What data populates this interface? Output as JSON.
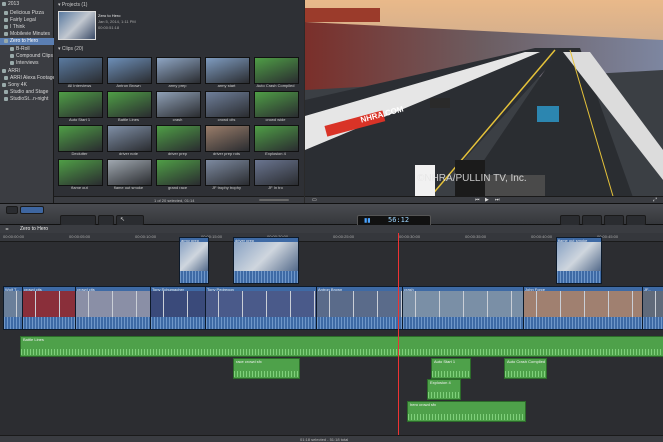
{
  "sidebar": {
    "items": [
      {
        "label": "2013",
        "selected": false
      },
      {
        "label": "Delicious Pizza",
        "selected": false
      },
      {
        "label": "Fairly Legal",
        "selected": false
      },
      {
        "label": "I Think",
        "selected": false
      },
      {
        "label": "Mobilevie Minutes",
        "selected": false
      },
      {
        "label": "Zero to Hero",
        "selected": true
      },
      {
        "label": "B-Roll",
        "selected": false
      },
      {
        "label": "Compound Clips",
        "selected": false
      },
      {
        "label": "Interviews",
        "selected": false
      },
      {
        "label": "ARRI",
        "selected": false
      },
      {
        "label": "ARRI Alexa Footage",
        "selected": false
      },
      {
        "label": "Sony 4K",
        "selected": false
      },
      {
        "label": "Studio and Stage",
        "selected": false
      },
      {
        "label": "StudioSt...n-night",
        "selected": false
      }
    ]
  },
  "browser": {
    "projects_label": "Projects",
    "projects_count": "(1)",
    "project": {
      "name": "Zero to Hero",
      "date": "Jan 5, 2014, 1:11 PM",
      "duration": "00:00:51:18"
    },
    "clips_label": "Clips",
    "clips_count": "(20)",
    "clips": [
      {
        "label": "All Interviews"
      },
      {
        "label": "Antron Brown"
      },
      {
        "label": "army prep"
      },
      {
        "label": "army start"
      },
      {
        "label": "Auto Crash Compiled"
      },
      {
        "label": "Auto Start 1"
      },
      {
        "label": "Battle Lines"
      },
      {
        "label": "crash"
      },
      {
        "label": "crowd cits"
      },
      {
        "label": "crowd wide"
      },
      {
        "label": "Declutter"
      },
      {
        "label": "driver note"
      },
      {
        "label": "driver prep"
      },
      {
        "label": "driver prep rots"
      },
      {
        "label": "Explosion 4"
      },
      {
        "label": "flame out"
      },
      {
        "label": "flame out smoke"
      },
      {
        "label": "grand race"
      },
      {
        "label": "JF trophy trophy"
      },
      {
        "label": "JF In tro"
      }
    ],
    "status": "1 of 20 selected, 01:14"
  },
  "viewer": {
    "banner": "NHRA.COM",
    "watermark": "©NHRA/PULLIN TV, Inc."
  },
  "toolbar": {
    "timecode": "56:12",
    "index_label": "Zero to Hero"
  },
  "timeline": {
    "ruler": [
      "00:00:00:00",
      "00:00:05:00",
      "00:00:10:00",
      "00:00:15:00",
      "00:00:20:00",
      "00:00:25:00",
      "00:00:30:00",
      "00:00:35:00",
      "00:00:40:00",
      "00:00:45:00"
    ],
    "connected": [
      {
        "label": "army prep"
      },
      {
        "label": "driver prep"
      },
      {
        "label": "flame out smoke"
      }
    ],
    "primary": [
      {
        "label": "Wolf T..."
      },
      {
        "label": "crowd cits"
      },
      {
        "label": "crowd cits"
      },
      {
        "label": "Tony Schumacher"
      },
      {
        "label": "Tony Pedregon"
      },
      {
        "label": "Antron Brown"
      },
      {
        "label": "crash"
      },
      {
        "label": "John Force"
      },
      {
        "label": "JF..."
      }
    ],
    "music": {
      "label": "Battle Lines"
    },
    "audio_clips": [
      {
        "label": "race crowd sfx"
      },
      {
        "label": "Auto Start 1"
      },
      {
        "label": "Auto Crash Compiled"
      },
      {
        "label": "Explosion 4"
      },
      {
        "label": "hero crowd sfx"
      }
    ],
    "status": "01:18 selected - 51:18 total"
  },
  "colors": {
    "selection": "#5b7fb3",
    "video_clip": "#3e6aa5",
    "audio_clip": "#4ea14a",
    "playhead": "#e33333"
  }
}
